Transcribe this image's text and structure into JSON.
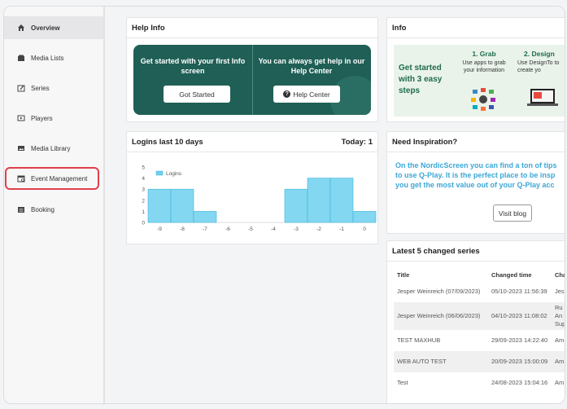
{
  "sidebar": {
    "items": [
      {
        "label": "Overview",
        "icon": "home-icon"
      },
      {
        "label": "Media Lists",
        "icon": "folder-icon"
      },
      {
        "label": "Series",
        "icon": "edit-icon"
      },
      {
        "label": "Players",
        "icon": "player-icon"
      },
      {
        "label": "Media Library",
        "icon": "image-icon"
      },
      {
        "label": "Event Management",
        "icon": "calendar-icon"
      },
      {
        "label": "Booking",
        "icon": "booking-icon"
      }
    ]
  },
  "help_info": {
    "title": "Help Info",
    "left_text": "Get started with your first Info screen",
    "left_button": "Got Started",
    "right_text": "You can always get help in our Help Center",
    "right_button": "Help Center"
  },
  "info": {
    "title": "Info",
    "banner_heading": "Get started with 3 easy steps",
    "step1_title": "1. Grab",
    "step1_text": "Use apps to grab your information",
    "step2_title": "2. Design",
    "step2_text": "Use DesignTo to create yo"
  },
  "logins": {
    "title": "Logins last 10 days",
    "today": "Today: 1",
    "legend": "Logins"
  },
  "inspiration": {
    "title": "Need Inspiration?",
    "line1": "On the NordicScreen you can find a ton of tips",
    "line2": "to use Q-Play. It is the perfect place to be insp",
    "line3": "you get the most value out of your Q-Play acc",
    "button": "Visit blog"
  },
  "series_table": {
    "title": "Latest 5 changed series",
    "headers": [
      "Title",
      "Changed time",
      "Cha"
    ],
    "rows": [
      {
        "title": "Jesper Weinreich (07/09/2023)",
        "time": "05/10-2023 11:56:39",
        "by": "Jes"
      },
      {
        "title": "Jesper Weinreich (06/06/2023)",
        "time": "04/10-2023 11:08:02",
        "by": "Ru An Sup"
      },
      {
        "title": "TEST MAXHUB",
        "time": "29/09-2023 14:22:40",
        "by": "Am"
      },
      {
        "title": "WEB AUTO TEST",
        "time": "20/09-2023 15:00:09",
        "by": "Am"
      },
      {
        "title": "Test",
        "time": "24/08-2023 15:04:16",
        "by": "Am"
      }
    ]
  },
  "chart_data": {
    "type": "bar",
    "categories": [
      "-9",
      "-8",
      "-7",
      "-6",
      "-5",
      "-4",
      "-3",
      "-2",
      "-1",
      "0"
    ],
    "series": [
      {
        "name": "Logins",
        "values": [
          3,
          3,
          1,
          0,
          0,
          0,
          3,
          4,
          4,
          1
        ]
      }
    ],
    "ylim": [
      0,
      5
    ],
    "yticks": [
      "0",
      "1",
      "2",
      "3",
      "4",
      "5"
    ],
    "color": "#6fd0ee",
    "legend": "top-left"
  }
}
